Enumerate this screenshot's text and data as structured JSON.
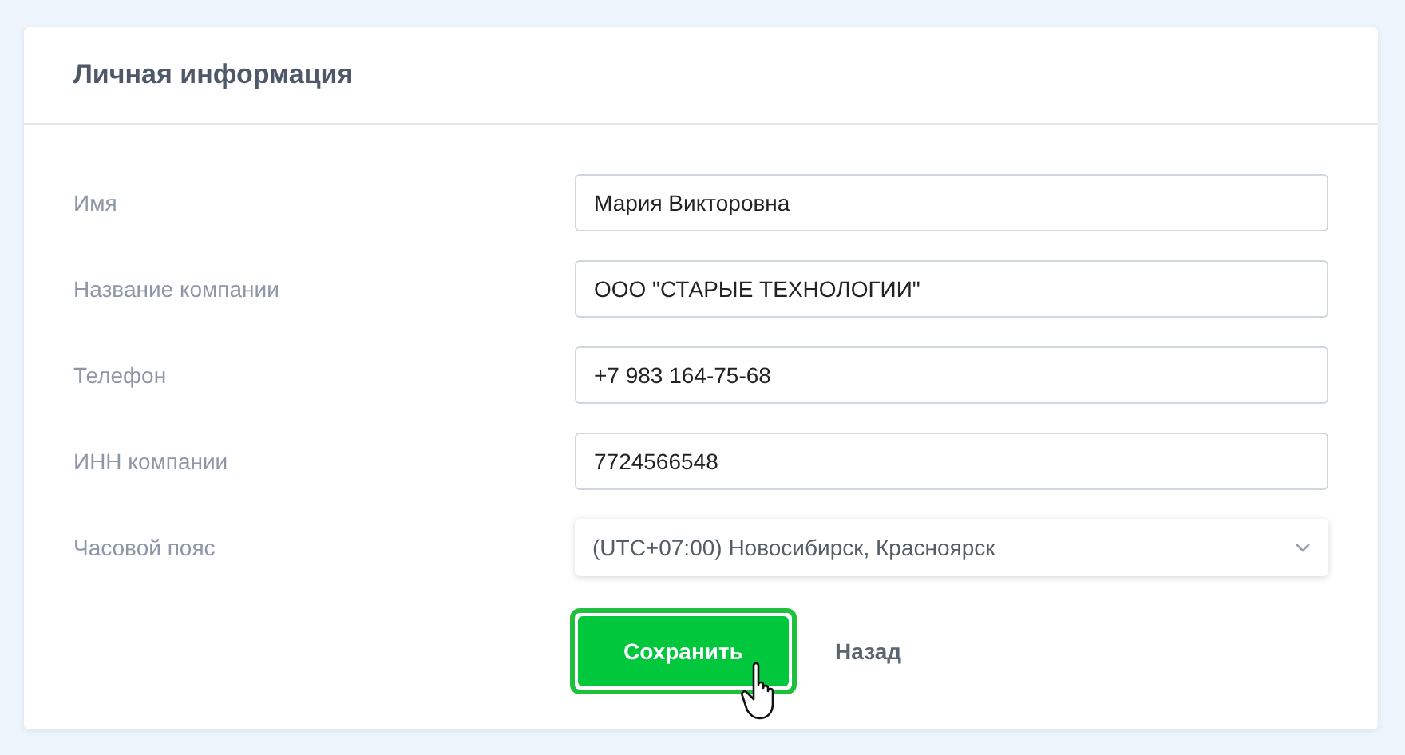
{
  "card": {
    "title": "Личная информация"
  },
  "fields": [
    {
      "kind": "text",
      "label": "Имя",
      "value": "Мария Викторовна"
    },
    {
      "kind": "text",
      "label": "Название компании",
      "value": "ООО \"СТАРЫЕ ТЕХНОЛОГИИ\""
    },
    {
      "kind": "text",
      "label": "Телефон",
      "value": "+7 983 164-75-68"
    },
    {
      "kind": "text",
      "label": "ИНН компании",
      "value": "7724566548"
    },
    {
      "kind": "select",
      "label": "Часовой пояс",
      "value": "(UTC+07:00) Новосибирск, Красноярск"
    }
  ],
  "actions": {
    "save": {
      "label": "Сохранить",
      "focused": true
    },
    "back": {
      "label": "Назад"
    }
  }
}
